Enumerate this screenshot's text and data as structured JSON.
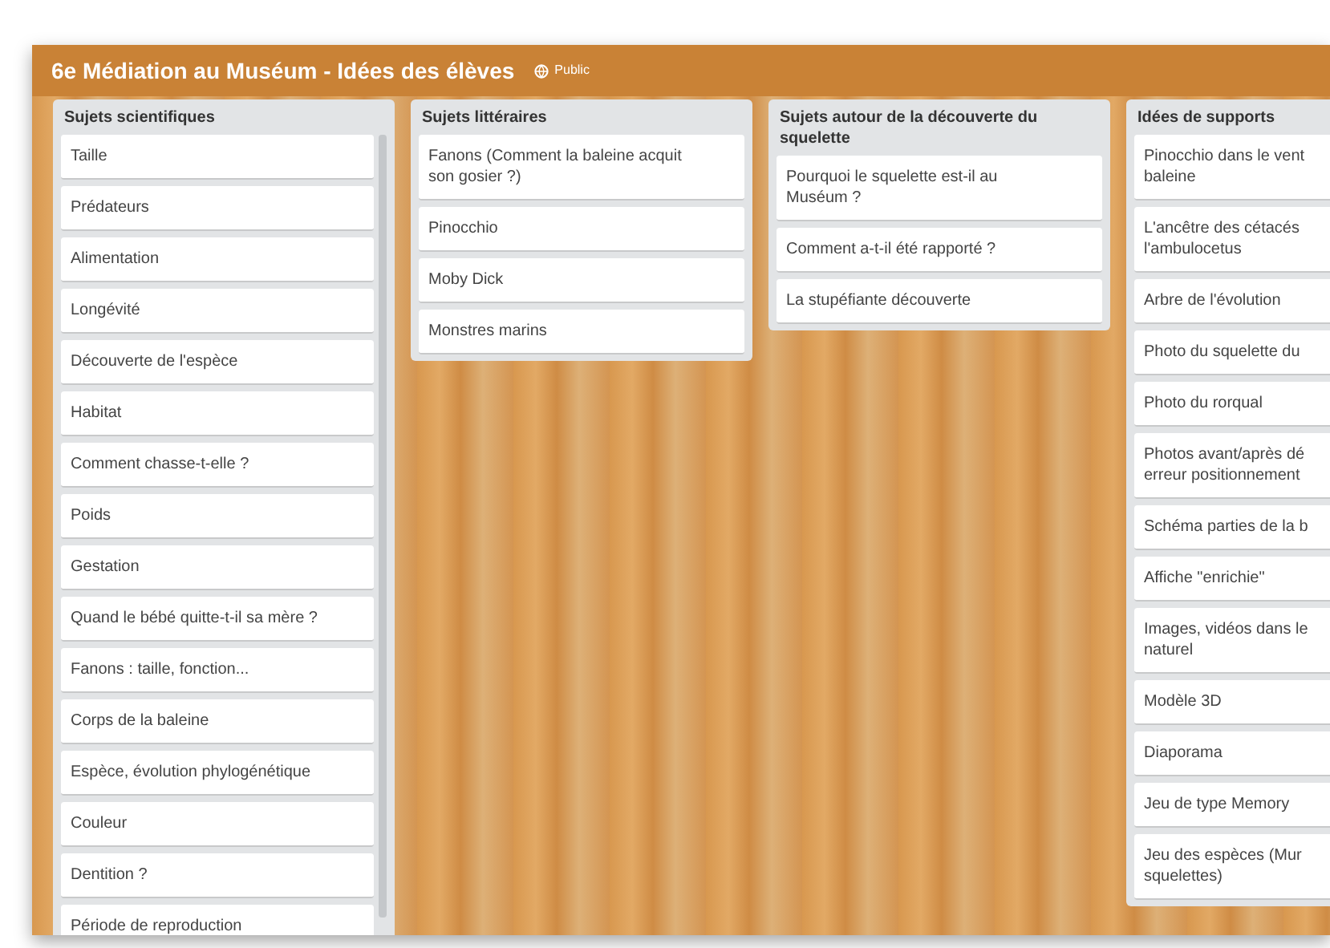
{
  "board": {
    "title": "6e Médiation au Muséum - Idées des élèves",
    "visibility": "Public"
  },
  "lists": [
    {
      "title": "Sujets scientifiques",
      "scrollbar": true,
      "cards": [
        {
          "lines": [
            "Taille"
          ]
        },
        {
          "lines": [
            "Prédateurs"
          ]
        },
        {
          "lines": [
            "Alimentation"
          ]
        },
        {
          "lines": [
            "Longévité"
          ]
        },
        {
          "lines": [
            "Découverte de l'espèce"
          ]
        },
        {
          "lines": [
            "Habitat"
          ]
        },
        {
          "lines": [
            "Comment chasse-t-elle ?"
          ]
        },
        {
          "lines": [
            "Poids"
          ]
        },
        {
          "lines": [
            "Gestation"
          ]
        },
        {
          "lines": [
            "Quand le bébé quitte-t-il sa mère ?"
          ]
        },
        {
          "lines": [
            "Fanons : taille, fonction..."
          ]
        },
        {
          "lines": [
            "Corps de la baleine"
          ]
        },
        {
          "lines": [
            "Espèce, évolution phylogénétique"
          ]
        },
        {
          "lines": [
            "Couleur"
          ]
        },
        {
          "lines": [
            "Dentition ?"
          ]
        },
        {
          "lines": [
            "Période de reproduction"
          ]
        }
      ]
    },
    {
      "title": "Sujets littéraires",
      "scrollbar": false,
      "cards": [
        {
          "lines": [
            "Fanons (Comment la baleine acquit",
            "son gosier ?)"
          ]
        },
        {
          "lines": [
            "Pinocchio"
          ]
        },
        {
          "lines": [
            "Moby Dick"
          ]
        },
        {
          "lines": [
            "Monstres marins"
          ]
        }
      ]
    },
    {
      "title": "Sujets autour de la découverte du squelette",
      "scrollbar": false,
      "cards": [
        {
          "lines": [
            "Pourquoi le squelette est-il au",
            "Muséum ?"
          ]
        },
        {
          "lines": [
            "Comment a-t-il été rapporté ?"
          ]
        },
        {
          "lines": [
            "La stupéfiante découverte"
          ]
        }
      ]
    },
    {
      "title": "Idées de supports",
      "scrollbar": false,
      "cards": [
        {
          "lines": [
            "Pinocchio dans le vent",
            "baleine"
          ]
        },
        {
          "lines": [
            "L'ancêtre des cétacés",
            "l'ambulocetus"
          ]
        },
        {
          "lines": [
            "Arbre de l'évolution"
          ]
        },
        {
          "lines": [
            "Photo du squelette du"
          ]
        },
        {
          "lines": [
            "Photo du rorqual"
          ]
        },
        {
          "lines": [
            "Photos avant/après dé",
            "erreur positionnement"
          ]
        },
        {
          "lines": [
            "Schéma parties de la b"
          ]
        },
        {
          "lines": [
            "Affiche \"enrichie\""
          ]
        },
        {
          "lines": [
            "Images, vidéos dans le",
            "naturel"
          ]
        },
        {
          "lines": [
            "Modèle 3D"
          ]
        },
        {
          "lines": [
            "Diaporama"
          ]
        },
        {
          "lines": [
            "Jeu de type Memory"
          ]
        },
        {
          "lines": [
            "Jeu des espèces (Mur",
            "squelettes)"
          ]
        }
      ]
    }
  ]
}
